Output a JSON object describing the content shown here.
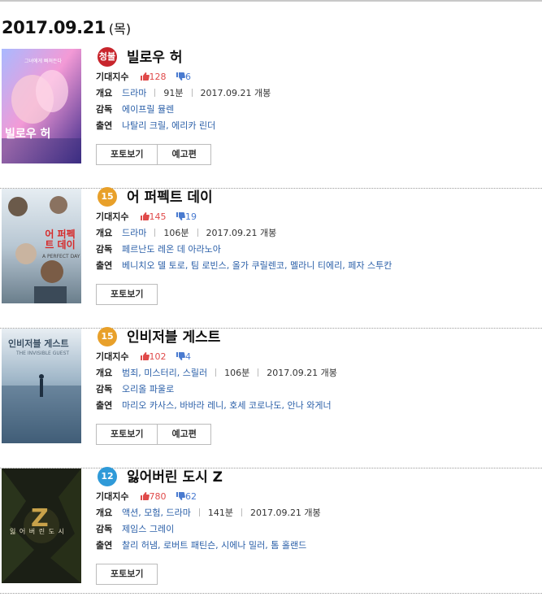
{
  "date": {
    "main": "2017.09.21",
    "day": "(목)"
  },
  "labels": {
    "expect": "기대지수",
    "summary": "개요",
    "director": "감독",
    "cast": "출연"
  },
  "movies": [
    {
      "rating": "청불",
      "rating_color": "#c8252c",
      "title": "빌로우 허",
      "likes": "128",
      "dislikes": "6",
      "genre": "드라마",
      "runtime": "91분",
      "release": "2017.09.21 개봉",
      "director": "에이프릴 뮬렌",
      "cast": "나탈리 크릴, 에리카 린더",
      "buttons": [
        "포토보기",
        "예고편"
      ],
      "poster_title": "빌로우 허",
      "poster_tagline": "그녀에게 빠져든다"
    },
    {
      "rating": "15",
      "rating_color": "#e8a02a",
      "title": "어 퍼펙트 데이",
      "likes": "145",
      "dislikes": "19",
      "genre": "드라마",
      "runtime": "106분",
      "release": "2017.09.21 개봉",
      "director": "페르난도 레온 데 아라노아",
      "cast": "베니치오 델 토로, 팀 로빈스, 올가 쿠릴렌코, 멜라니 티에리, 페자 스투칸",
      "buttons": [
        "포토보기"
      ],
      "poster_title": "어 퍼펙트 데이",
      "poster_tagline": "A PERFECT DAY"
    },
    {
      "rating": "15",
      "rating_color": "#e8a02a",
      "title": "인비저블 게스트",
      "likes": "102",
      "dislikes": "4",
      "genre": "범죄, 미스터리, 스릴러",
      "runtime": "106분",
      "release": "2017.09.21 개봉",
      "director": "오리올 파울로",
      "cast": "마리오 카사스, 바바라 레니, 호세 코로나도, 안나 와게너",
      "buttons": [
        "포토보기",
        "예고편"
      ],
      "poster_title": "인비저블 게스트",
      "poster_tagline": "THE INVISIBLE GUEST"
    },
    {
      "rating": "12",
      "rating_color": "#2f9ad8",
      "title": "잃어버린 도시 Z",
      "likes": "780",
      "dislikes": "62",
      "genre": "액션, 모험, 드라마",
      "runtime": "141분",
      "release": "2017.09.21 개봉",
      "director": "제임스 그레이",
      "cast": "찰리 허냄, 로버트 패틴슨, 시에나 밀러, 톰 홀랜드",
      "buttons": [
        "포토보기"
      ],
      "poster_title": "잃 어 버 린 도 시",
      "poster_tagline": "Z"
    }
  ],
  "colors": {
    "like": "#e04a4a",
    "dislike": "#4a7bd0",
    "link": "#2a5fa8"
  }
}
